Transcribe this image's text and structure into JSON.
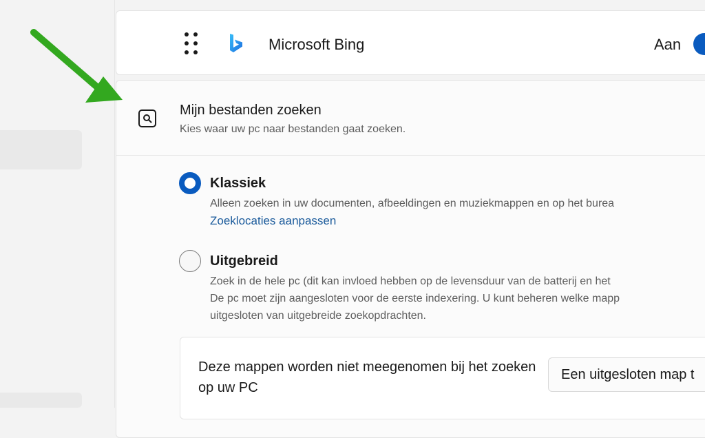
{
  "search_providers": {
    "bing": {
      "name": "Microsoft Bing",
      "toggle_state": "Aan",
      "icons": {
        "drag": "drag-dots-icon",
        "logo": "bing-logo-icon"
      }
    }
  },
  "search_files": {
    "title": "Mijn bestanden zoeken",
    "subtitle": "Kies waar uw pc naar bestanden gaat zoeken.",
    "icon": "search-folder-icon",
    "options": [
      {
        "label": "Klassiek",
        "selected": true,
        "description": "Alleen zoeken in uw documenten, afbeeldingen en muziekmappen en op het burea",
        "link": "Zoeklocaties aanpassen"
      },
      {
        "label": "Uitgebreid",
        "selected": false,
        "description_lines": [
          "Zoek in de hele pc (dit kan invloed hebben op de levensduur van de batterij en het",
          "De pc moet zijn aangesloten voor de eerste indexering. U kunt beheren welke mapp",
          "uitgesloten van uitgebreide zoekopdrachten."
        ]
      }
    ],
    "excluded": {
      "text": "Deze mappen worden niet meegenomen bij het zoeken op uw PC",
      "button": "Een uitgesloten map t"
    }
  },
  "annotation": {
    "icon": "green-arrow-icon",
    "color": "#33a81f"
  },
  "colors": {
    "accent": "#0a5bbf",
    "link": "#1a5a9b",
    "page_bg": "#f3f3f3"
  }
}
